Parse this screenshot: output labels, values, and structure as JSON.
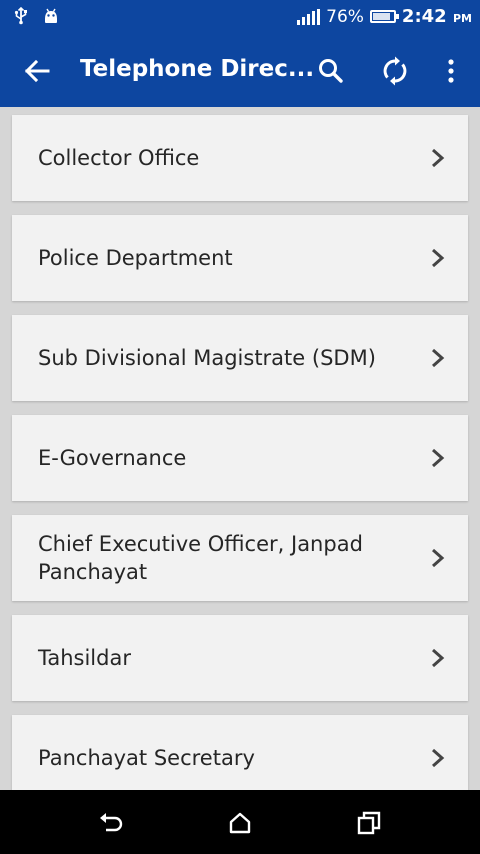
{
  "status_bar": {
    "battery_percent": "76%",
    "battery_level": 0.76,
    "time": "2:42",
    "time_suffix": "PM",
    "icons": [
      "usb-icon",
      "android-debug-icon",
      "signal-icon",
      "battery-icon"
    ]
  },
  "app_bar": {
    "title": "Telephone Direc...",
    "actions": [
      "search-icon",
      "refresh-icon",
      "overflow-menu-icon"
    ],
    "color": "#0d46a0"
  },
  "directory": {
    "items": [
      {
        "label": "Collector Office"
      },
      {
        "label": "Police Department"
      },
      {
        "label": "Sub Divisional Magistrate (SDM)"
      },
      {
        "label": "E-Governance"
      },
      {
        "label": "Chief Executive Officer, Janpad Panchayat"
      },
      {
        "label": "Tahsildar"
      },
      {
        "label": "Panchayat Secretary"
      }
    ]
  },
  "nav_bar": {
    "buttons": [
      "back-nav-icon",
      "home-nav-icon",
      "recents-nav-icon"
    ]
  }
}
